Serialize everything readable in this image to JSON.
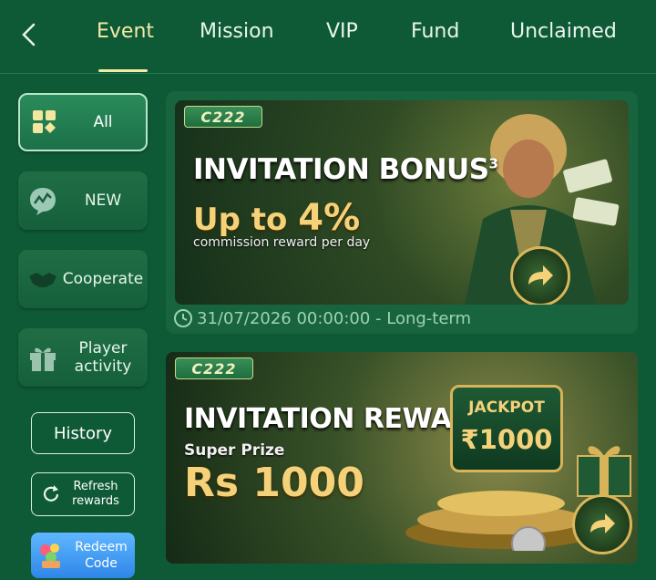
{
  "tabs": [
    {
      "label": "Event",
      "active": true
    },
    {
      "label": "Mission",
      "active": false
    },
    {
      "label": "VIP",
      "active": false
    },
    {
      "label": "Fund",
      "active": false
    },
    {
      "label": "Unclaimed",
      "active": false
    }
  ],
  "sidebar": {
    "items": [
      {
        "label": "All",
        "icon": "grid-icon",
        "active": true
      },
      {
        "label": "NEW",
        "icon": "chat-trend-icon",
        "active": false
      },
      {
        "label": "Cooperate",
        "icon": "handshake-icon",
        "active": false
      },
      {
        "label": "Player activity",
        "icon": "gift-icon",
        "active": false
      }
    ],
    "history_label": "History",
    "refresh_label": "Refresh rewards",
    "redeem_label": "Redeem Code"
  },
  "banners": [
    {
      "logo": "C222",
      "title": "INVITATION BONUS",
      "superscript": "3",
      "highlight_prefix": "Up to ",
      "highlight_value": "4%",
      "subtitle": "commission reward per day",
      "footer": "31/07/2026 00:00:00 - Long-term"
    },
    {
      "logo": "C222",
      "title": "INVITATION REWARD",
      "subtitle": "Super Prize",
      "highlight_value": "Rs 1000",
      "jackpot_label": "JACKPOT",
      "jackpot_amount": "₹1000"
    }
  ],
  "colors": {
    "background": "#0f5a36",
    "active_tab": "#f5e9a6",
    "gold": "#f5d27a",
    "redeem": "#3f9af0"
  }
}
